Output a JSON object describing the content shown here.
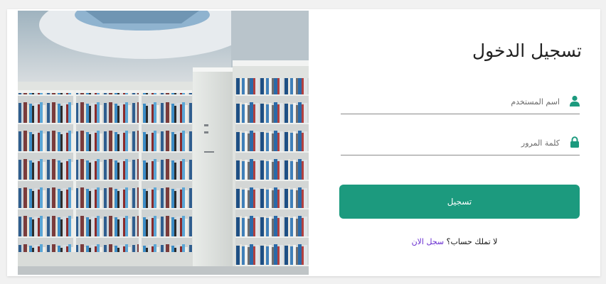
{
  "login": {
    "title": "تسجيل الدخول",
    "username_placeholder": "اسم المستخدم",
    "password_placeholder": "كلمة المرور",
    "submit_label": "تسجيل",
    "signup_prompt": "لا تملك حساب؟",
    "signup_link": "سجل الان"
  },
  "icons": {
    "username": "user-icon",
    "password": "lock-icon"
  },
  "colors": {
    "accent": "#1c9a7e",
    "link": "#6a2fd0",
    "page_background": "#f1f1f1",
    "card_background": "#ffffff"
  }
}
